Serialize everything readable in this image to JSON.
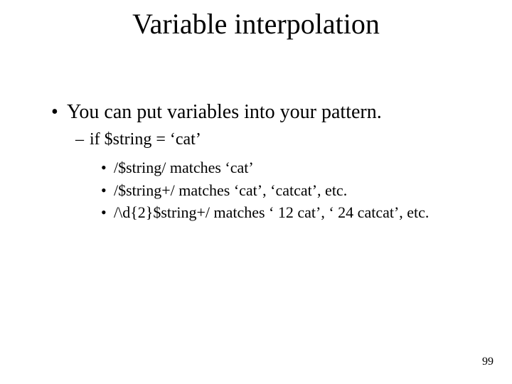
{
  "title": "Variable interpolation",
  "bullets": {
    "main": "You can put variables into your pattern.",
    "sub": "if $string = ‘cat’",
    "examples": [
      "/$string/  matches ‘cat’",
      "/$string+/ matches ‘cat’, ‘catcat’, etc.",
      "/\\d{2}$string+/ matches ‘ 12 cat’, ‘ 24 catcat’, etc."
    ]
  },
  "page_number": "99"
}
